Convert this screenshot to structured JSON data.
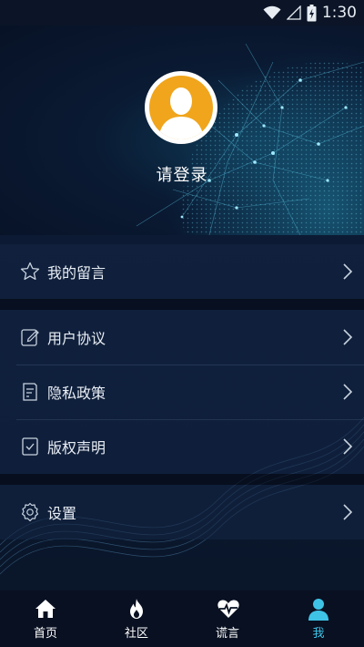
{
  "status_bar": {
    "time": "1:30",
    "icons": [
      "wifi-icon",
      "signal-icon",
      "battery-charging-icon"
    ]
  },
  "profile": {
    "login_prompt": "请登录",
    "avatar_icon": "default-user-avatar"
  },
  "menu": {
    "groups": [
      {
        "items": [
          {
            "label": "我的留言",
            "icon": "star-icon"
          }
        ]
      },
      {
        "items": [
          {
            "label": "用户协议",
            "icon": "edit-icon"
          },
          {
            "label": "隐私政策",
            "icon": "document-icon"
          },
          {
            "label": "版权声明",
            "icon": "bookmark-icon"
          }
        ]
      },
      {
        "items": [
          {
            "label": "设置",
            "icon": "gear-icon"
          }
        ]
      }
    ]
  },
  "tabbar": {
    "tabs": [
      {
        "label": "首页",
        "icon": "home-icon",
        "active": false
      },
      {
        "label": "社区",
        "icon": "flame-icon",
        "active": false
      },
      {
        "label": "谎言",
        "icon": "heartbeat-icon",
        "active": false
      },
      {
        "label": "我",
        "icon": "user-icon",
        "active": true
      }
    ]
  },
  "colors": {
    "accent": "#3ec3e6",
    "avatar_orange": "#f0a51c",
    "background": "#0a1326"
  }
}
